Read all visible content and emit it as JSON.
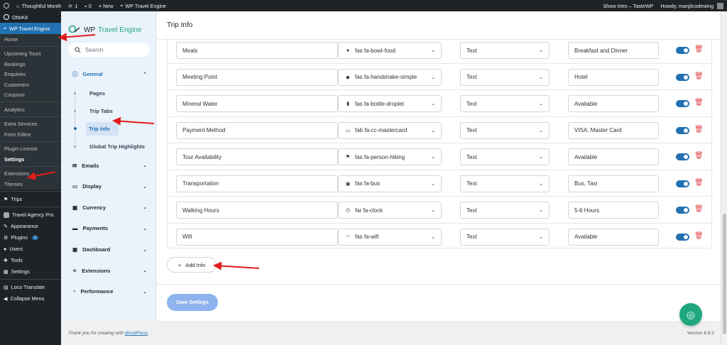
{
  "admin_bar": {
    "site_name": "Thoughtful Month",
    "updates_count": "1",
    "comments_count": "0",
    "new_label": "+ New",
    "plugin_label": "WP Travel Engine",
    "show_intro": "Show Intro – TasteWP",
    "howdy": "Howdy, manjilcodewing"
  },
  "wp_menu": {
    "top_item": "OttoKit",
    "active_item": "WP Travel Engine",
    "submenu": [
      "Home",
      "Upcoming Tours",
      "Bookings",
      "Enquiries",
      "Customers",
      "Coupons",
      "Analytics",
      "Extra Services",
      "Form Editor",
      "Plugin License",
      "Settings",
      "Extensions",
      "Themes"
    ],
    "items": [
      {
        "label": "Trips",
        "icon": "hiking-icon"
      },
      {
        "label": "Travel Agency Pro",
        "icon": "square-icon"
      },
      {
        "label": "Appearance",
        "icon": "brush-icon"
      },
      {
        "label": "Plugins",
        "icon": "plug-icon",
        "badge": "1"
      },
      {
        "label": "Users",
        "icon": "user-icon"
      },
      {
        "label": "Tools",
        "icon": "wrench-icon"
      },
      {
        "label": "Settings",
        "icon": "settings-icon"
      },
      {
        "label": "Loco Translate",
        "icon": "translate-icon"
      },
      {
        "label": "Collapse Menu",
        "icon": "collapse-icon"
      }
    ]
  },
  "settings_panel": {
    "logo_prefix": "WP",
    "logo_brand": "Travel Engine",
    "search_placeholder": "Search",
    "general": {
      "label": "General",
      "subitems": [
        "Pages",
        "Trip Tabs",
        "Trip Info",
        "Global Trip Highlights"
      ]
    },
    "sections": [
      "Emails",
      "Display",
      "Currency",
      "Payments",
      "Dashboard",
      "Extensions",
      "Performance"
    ]
  },
  "page": {
    "title": "Trip Info",
    "rows": [
      {
        "name": "Meals",
        "icon": "fas fa-bowl-food",
        "type": "Text",
        "value": "Breakfast and Dinner"
      },
      {
        "name": "Meeting Point",
        "icon": "fas fa-handshake-simple",
        "type": "Text",
        "value": "Hotel"
      },
      {
        "name": "Mineral Water",
        "icon": "fas fa-bottle-droplet",
        "type": "Text",
        "value": "Available"
      },
      {
        "name": "Payment Method",
        "icon": "fab fa-cc-mastercard",
        "type": "Text",
        "value": "VISA, Master Card"
      },
      {
        "name": "Tour Availability",
        "icon": "fas fa-person-hiking",
        "type": "Text",
        "value": "Available"
      },
      {
        "name": "Transportation",
        "icon": "fas fa-bus",
        "type": "Text",
        "value": "Bus, Taxi"
      },
      {
        "name": "Walking Hours",
        "icon": "far fa-clock",
        "type": "Text",
        "value": "5-6 Hours"
      },
      {
        "name": "Wifi",
        "icon": "fas fa-wifi",
        "type": "Text",
        "value": "Available"
      }
    ],
    "add_button": "Add Info",
    "save_button": "Save Settings"
  },
  "footer": {
    "thanks_prefix": "Thank you for creating with",
    "wordpress_link": "WordPress",
    "thanks_suffix": ".",
    "version": "Version 6.8.2"
  },
  "colors": {
    "accent": "#2271b1",
    "brand": "#1fa87e",
    "danger": "#e0474c",
    "arrow": "#e21b1b"
  }
}
